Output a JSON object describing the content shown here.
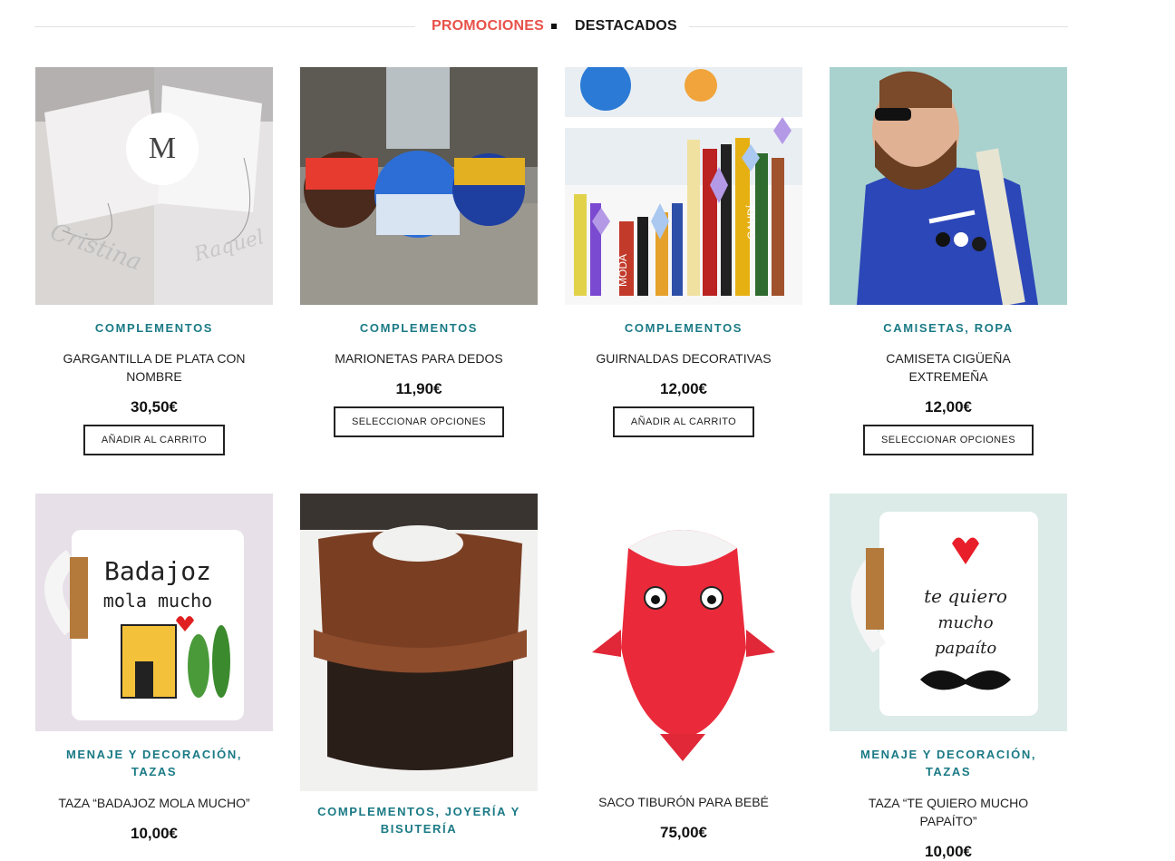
{
  "tabs": {
    "promotions": "PROMOCIONES",
    "featured": "DESTACADOS",
    "active": "promotions"
  },
  "colors": {
    "accent_red": "#e8514a",
    "category_teal": "#1a7a85"
  },
  "products": [
    {
      "image": "silver-name-necklace-photo",
      "category": [
        "COMPLEMENTOS"
      ],
      "name": "GARGANTILLA DE PLATA CON NOMBRE",
      "price": "30,50€",
      "button": "AÑADIR AL CARRITO"
    },
    {
      "image": "finger-puppets-photo",
      "category": [
        "COMPLEMENTOS"
      ],
      "name": "MARIONETAS PARA DEDOS",
      "price": "11,90€",
      "button": "SELECCIONAR OPCIONES"
    },
    {
      "image": "decorative-garland-photo",
      "category": [
        "COMPLEMENTOS"
      ],
      "name": "GUIRNALDAS DECORATIVAS",
      "price": "12,00€",
      "button": "AÑADIR AL CARRITO"
    },
    {
      "image": "stork-tshirt-photo",
      "category": [
        "CAMISETAS",
        "ROPA"
      ],
      "name": "CAMISETA CIGÜEÑA EXTREMEÑA",
      "price": "12,00€",
      "button": "SELECCIONAR OPCIONES"
    },
    {
      "image": "badajoz-mug-photo",
      "category": [
        "MENAJE Y DECORACIÓN",
        "TAZAS"
      ],
      "name": "TAZA “BADAJOZ MOLA MUCHO”",
      "price": "10,00€",
      "button": ""
    },
    {
      "image": "copper-cuff-photo",
      "category": [
        "COMPLEMENTOS",
        "JOYERÍA Y BISUTERÍA"
      ],
      "name": "",
      "price": "",
      "button": ""
    },
    {
      "image": "shark-sleeping-bag-photo",
      "category": [],
      "name": "SACO TIBURÓN PARA BEBÉ",
      "price": "75,00€",
      "button": ""
    },
    {
      "image": "papaito-mug-photo",
      "category": [
        "MENAJE Y DECORACIÓN",
        "TAZAS"
      ],
      "name": "TAZA “TE QUIERO MUCHO PAPAÍTO”",
      "price": "10,00€",
      "button": ""
    }
  ],
  "image_text": {
    "mug1_line1": "Badajoz",
    "mug1_line2": "mola mucho",
    "mug2_line1": "te quiero",
    "mug2_line2": "mucho",
    "mug2_line3": "papaíto",
    "necklace1": "Cristina",
    "necklace2": "Raquel",
    "book_spine1": "MODA",
    "book_spine2": "GAUDÍ"
  }
}
